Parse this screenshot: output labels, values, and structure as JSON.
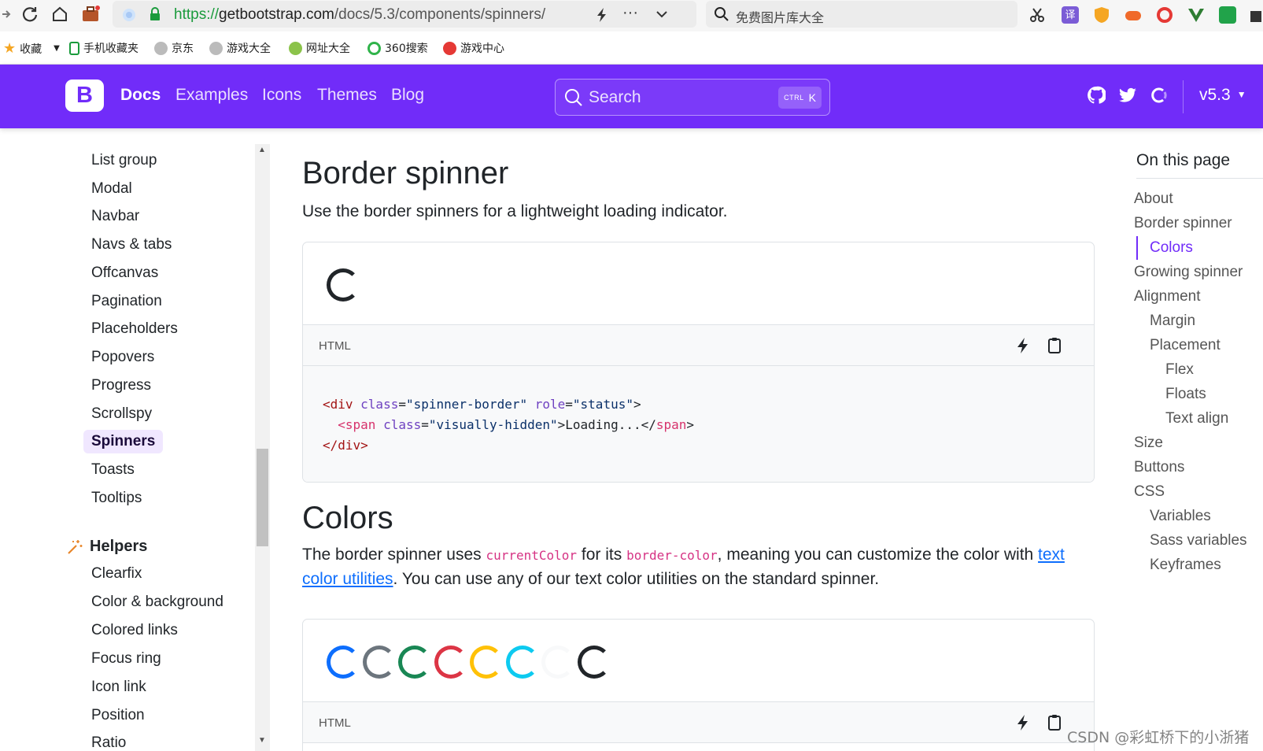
{
  "browser": {
    "url_scheme": "https://",
    "url_host": "getbootstrap.com",
    "url_path": "/docs/5.3/components/spinners/",
    "search_placeholder": "免费图片库大全",
    "bookmarks": [
      "收藏",
      "手机收藏夹",
      "京东",
      "游戏大全",
      "网址大全",
      "360搜索",
      "游戏中心"
    ]
  },
  "navbar": {
    "brand": "B",
    "links": [
      "Docs",
      "Examples",
      "Icons",
      "Themes",
      "Blog"
    ],
    "search_label": "Search",
    "search_kbd_ctrl": "CTRL",
    "search_kbd_key": "K",
    "version": "v5.3"
  },
  "sidebar": {
    "items": [
      "List group",
      "Modal",
      "Navbar",
      "Navs & tabs",
      "Offcanvas",
      "Pagination",
      "Placeholders",
      "Popovers",
      "Progress",
      "Scrollspy",
      "Spinners",
      "Toasts",
      "Tooltips"
    ],
    "active": "Spinners",
    "helpers_title": "Helpers",
    "helpers_items": [
      "Clearfix",
      "Color & background",
      "Colored links",
      "Focus ring",
      "Icon link",
      "Position",
      "Ratio"
    ]
  },
  "content": {
    "border_spinner_title": "Border spinner",
    "border_spinner_lead": "Use the border spinners for a lightweight loading indicator.",
    "code_lang": "HTML",
    "code": {
      "l1_open": "<div",
      "l1_attr1": " class",
      "l1_val1": "\"spinner-border\"",
      "l1_attr2": " role",
      "l1_val2": "\"status\"",
      "l1_close": ">",
      "l2_open": "  <span",
      "l2_attr": " class",
      "l2_val": "\"visually-hidden\"",
      "l2_text": ">Loading...</",
      "l2_tag": "span",
      "l2_close": ">",
      "l3": "</div>"
    },
    "colors_title": "Colors",
    "colors_lead_1": "The border spinner uses ",
    "colors_code_1": "currentColor",
    "colors_lead_2": " for its ",
    "colors_code_2": "border-color",
    "colors_lead_3": ", meaning you can customize the color with ",
    "colors_link": "text color utilities",
    "colors_lead_4": ". You can use any of our text color utilities on the standard spinner.",
    "spinner_colors": [
      "#0d6efd",
      "#6c757d",
      "#198754",
      "#dc3545",
      "#ffc107",
      "#0dcaf0",
      "#f8f9fa",
      "#212529"
    ]
  },
  "toc": {
    "title": "On this page",
    "items": [
      {
        "label": "About",
        "level": 0
      },
      {
        "label": "Border spinner",
        "level": 0
      },
      {
        "label": "Colors",
        "level": 1,
        "active": true
      },
      {
        "label": "Growing spinner",
        "level": 0
      },
      {
        "label": "Alignment",
        "level": 0
      },
      {
        "label": "Margin",
        "level": 1
      },
      {
        "label": "Placement",
        "level": 1
      },
      {
        "label": "Flex",
        "level": 2
      },
      {
        "label": "Floats",
        "level": 2
      },
      {
        "label": "Text align",
        "level": 2
      },
      {
        "label": "Size",
        "level": 0
      },
      {
        "label": "Buttons",
        "level": 0
      },
      {
        "label": "CSS",
        "level": 0
      },
      {
        "label": "Variables",
        "level": 1
      },
      {
        "label": "Sass variables",
        "level": 1
      },
      {
        "label": "Keyframes",
        "level": 1
      }
    ]
  },
  "watermark": "CSDN @彩虹桥下的小浙猪",
  "colors": {
    "brand": "#712cf9",
    "link": "#0d6efd",
    "code": "#d63384"
  }
}
